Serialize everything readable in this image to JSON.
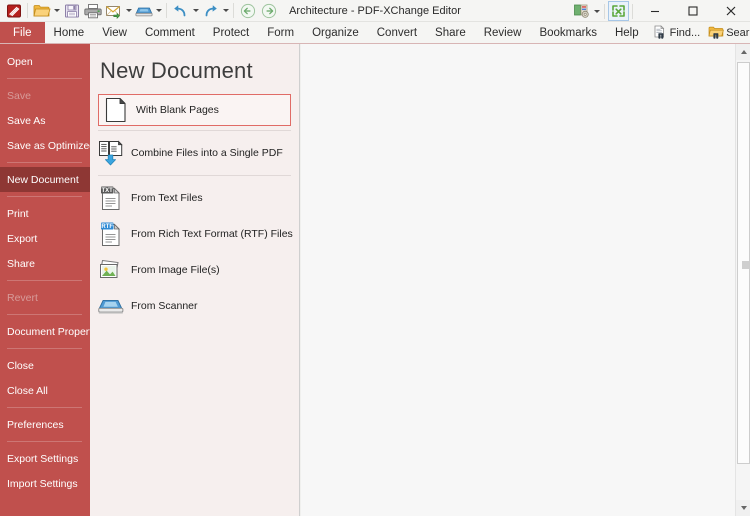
{
  "window": {
    "title": "Architecture - PDF-XChange Editor",
    "minimize_label": "─",
    "maximize_label": "☐",
    "close_label": "✕"
  },
  "quick_access": {
    "items": [
      {
        "name": "app-logo-icon",
        "label": "PDF-XChange Editor",
        "dropdown": false
      },
      {
        "name": "open-file-icon",
        "label": "Open",
        "dropdown": true
      },
      {
        "name": "save-icon",
        "label": "Save",
        "dropdown": false
      },
      {
        "name": "print-icon",
        "label": "Print",
        "dropdown": false
      },
      {
        "name": "email-icon",
        "label": "Email",
        "dropdown": true
      },
      {
        "name": "scanner-icon",
        "label": "From Scanner",
        "dropdown": true
      },
      {
        "name": "undo-icon",
        "label": "Undo",
        "dropdown": true
      },
      {
        "name": "redo-icon",
        "label": "Redo",
        "dropdown": true
      },
      {
        "name": "back-icon",
        "label": "Previous View",
        "dropdown": false
      },
      {
        "name": "forward-icon",
        "label": "Next View",
        "dropdown": false
      }
    ]
  },
  "titlebar_right": {
    "customize_label": "Customize",
    "fullscreen_label": "Full Screen"
  },
  "menu": {
    "file_label": "File",
    "items": [
      "Home",
      "View",
      "Comment",
      "Protect",
      "Form",
      "Organize",
      "Convert",
      "Share",
      "Review",
      "Bookmarks",
      "Help"
    ],
    "find_label": "Find...",
    "search_label": "Search...",
    "collapse_label": "˄"
  },
  "sidebar": {
    "groups": [
      {
        "items": [
          {
            "label": "Open",
            "state": "normal"
          }
        ]
      },
      {
        "items": [
          {
            "label": "Save",
            "state": "disabled"
          },
          {
            "label": "Save As",
            "state": "normal"
          },
          {
            "label": "Save as Optimized",
            "state": "normal"
          }
        ]
      },
      {
        "items": [
          {
            "label": "New Document",
            "state": "active"
          }
        ]
      },
      {
        "items": [
          {
            "label": "Print",
            "state": "normal"
          },
          {
            "label": "Export",
            "state": "normal"
          },
          {
            "label": "Share",
            "state": "normal"
          }
        ]
      },
      {
        "items": [
          {
            "label": "Revert",
            "state": "disabled"
          }
        ]
      },
      {
        "items": [
          {
            "label": "Document Properties",
            "state": "normal"
          }
        ]
      },
      {
        "items": [
          {
            "label": "Close",
            "state": "normal"
          },
          {
            "label": "Close All",
            "state": "normal"
          }
        ]
      },
      {
        "items": [
          {
            "label": "Preferences",
            "state": "normal"
          }
        ]
      },
      {
        "items": [
          {
            "label": "Export Settings",
            "state": "normal"
          },
          {
            "label": "Import Settings",
            "state": "normal"
          }
        ]
      }
    ]
  },
  "panel": {
    "title": "New Document",
    "options": [
      {
        "label": "With Blank Pages",
        "icon": "blank-page-icon",
        "selected": true
      },
      {
        "label": "Combine Files into a Single PDF",
        "icon": "combine-files-icon",
        "selected": false
      },
      {
        "label": "From Text Files",
        "icon": "text-file-icon",
        "selected": false
      },
      {
        "label": "From Rich Text Format (RTF) Files",
        "icon": "rtf-file-icon",
        "selected": false
      },
      {
        "label": "From Image File(s)",
        "icon": "image-file-icon",
        "selected": false
      },
      {
        "label": "From Scanner",
        "icon": "scanner-icon",
        "selected": false
      }
    ]
  },
  "colors": {
    "accent_red": "#c0504d",
    "accent_red_dark": "#8e3734",
    "selection_border": "#e06b66",
    "panel_bg": "#f6efee",
    "doc_bg": "#f7f7f7"
  }
}
